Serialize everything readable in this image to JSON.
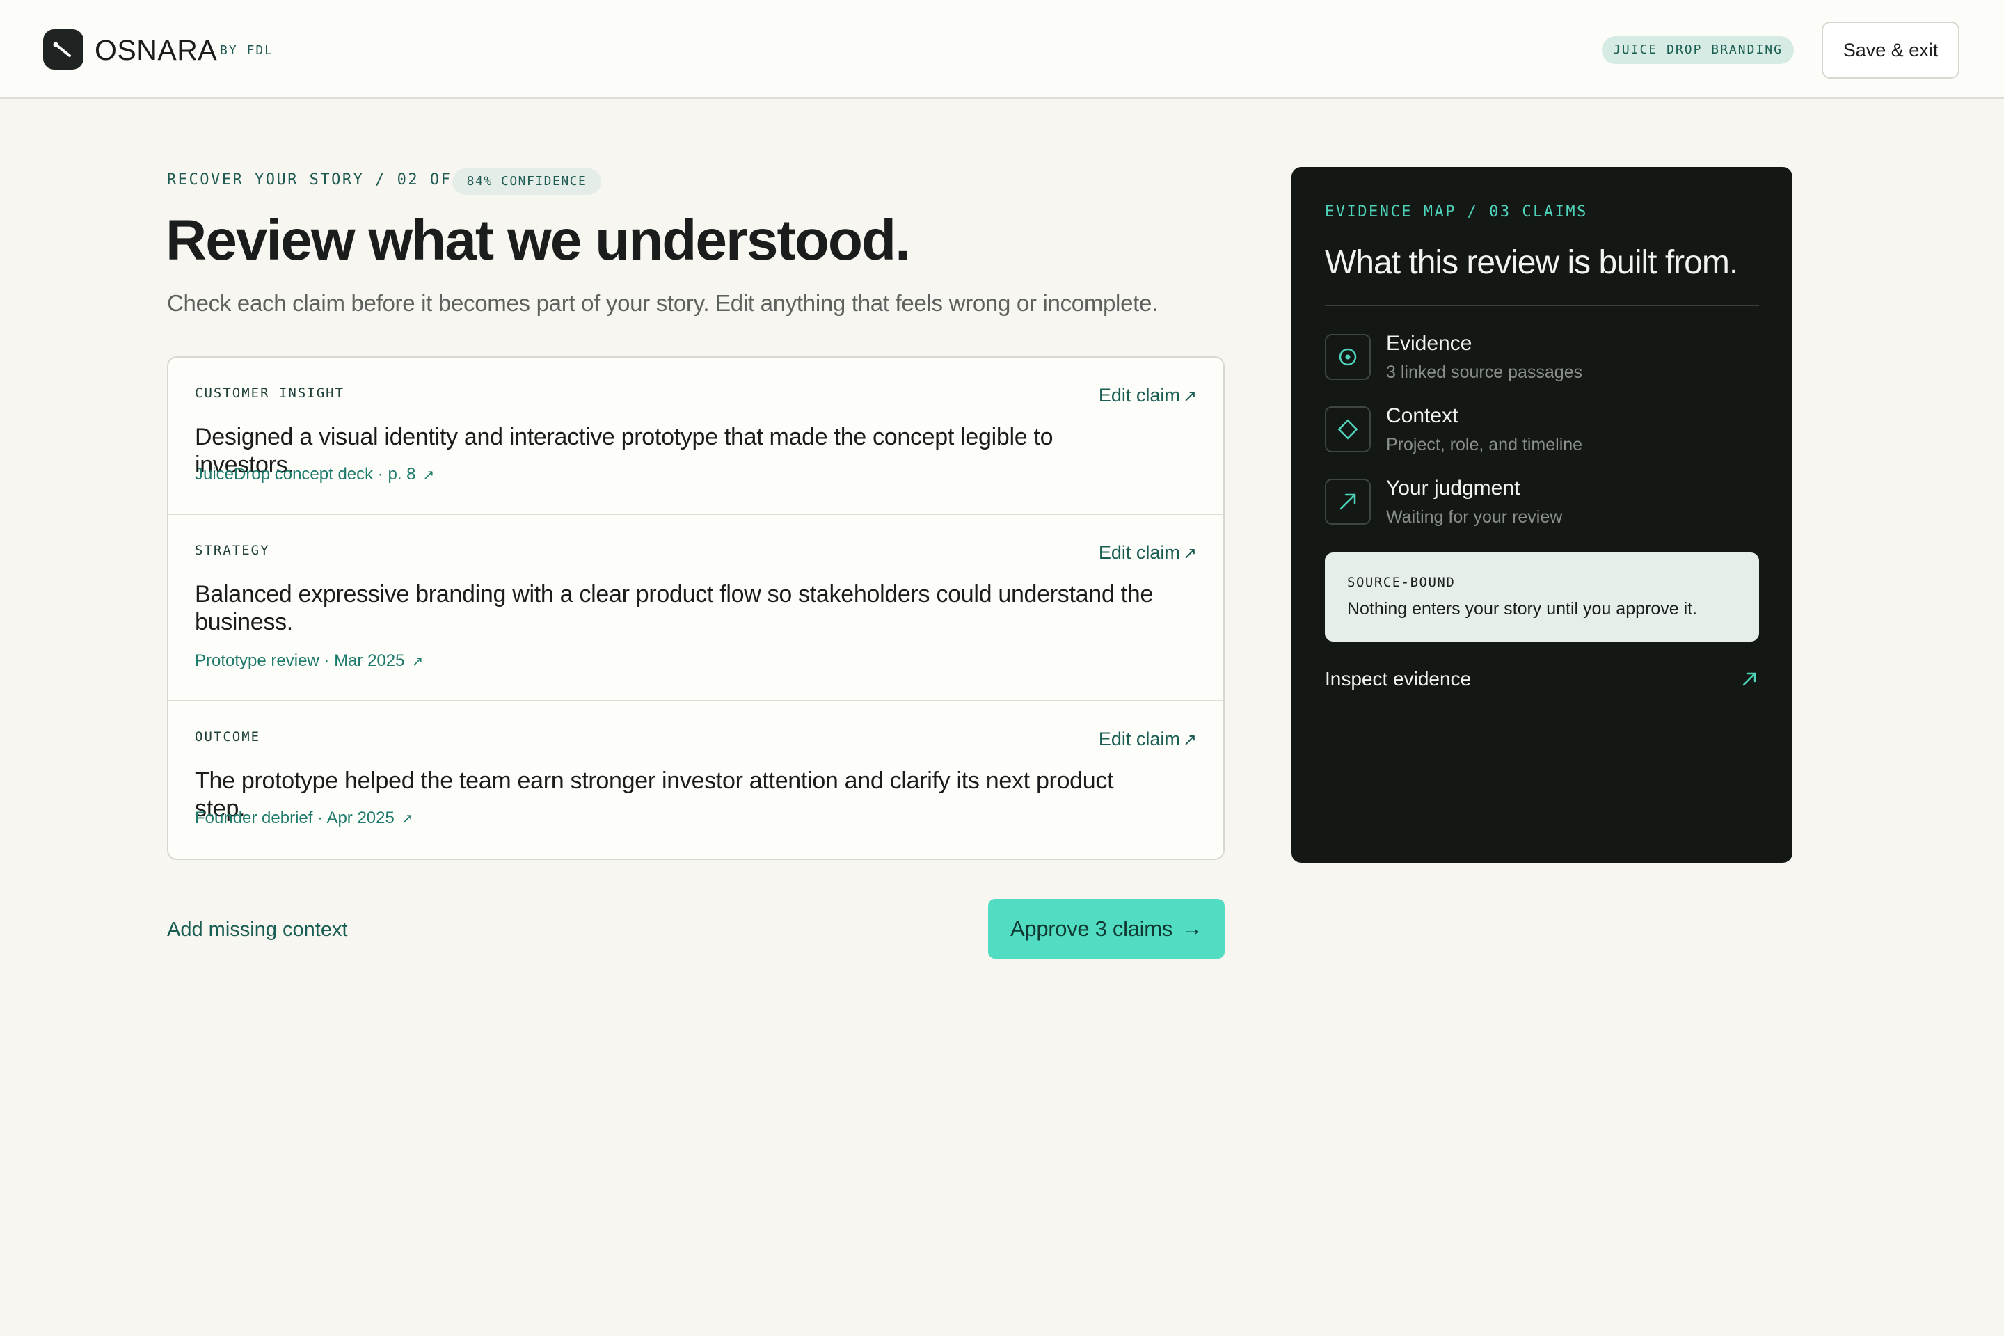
{
  "header": {
    "brand": "OSNARA",
    "brand_suffix": "BY FDL",
    "project_pill": "JUICE DROP BRANDING",
    "save_label": "Save & exit"
  },
  "intro": {
    "eyebrow": "RECOVER YOUR STORY / 02 OF 04",
    "confidence": "84% CONFIDENCE",
    "title": "Review what we understood.",
    "subtitle": "Check each claim before it becomes part of your story. Edit anything that feels wrong or incomplete."
  },
  "claims": [
    {
      "label": "CUSTOMER INSIGHT",
      "edit_label": "Edit claim",
      "text": "Designed a visual identity and interactive prototype that made the concept legible to investors.",
      "source": "JuiceDrop concept deck · p. 8"
    },
    {
      "label": "STRATEGY",
      "edit_label": "Edit claim",
      "text": "Balanced expressive branding with a clear product flow so stakeholders could understand the business.",
      "source": "Prototype review · Mar 2025"
    },
    {
      "label": "OUTCOME",
      "edit_label": "Edit claim",
      "text": "The prototype helped the team earn stronger investor attention and clarify its next product step.",
      "source": "Founder debrief · Apr 2025"
    }
  ],
  "actions": {
    "add_context": "Add missing context",
    "approve": "Approve 3 claims"
  },
  "evidence": {
    "eyebrow": "EVIDENCE MAP / 03 CLAIMS",
    "title": "What this review is built from.",
    "items": [
      {
        "icon": "target-icon",
        "title": "Evidence",
        "subtitle": "3 linked source passages"
      },
      {
        "icon": "diamond-icon",
        "title": "Context",
        "subtitle": "Project, role, and timeline"
      },
      {
        "icon": "arrow-up-right-icon",
        "title": "Your judgment",
        "subtitle": "Waiting for your review"
      }
    ],
    "source_label": "SOURCE-BOUND",
    "source_text": "Nothing enters your story until you approve it.",
    "inspect_label": "Inspect evidence"
  },
  "colors": {
    "accent": "#52ddc3",
    "accent_text": "#1a5d52",
    "panel": "#131815",
    "background": "#f7f6f1"
  }
}
